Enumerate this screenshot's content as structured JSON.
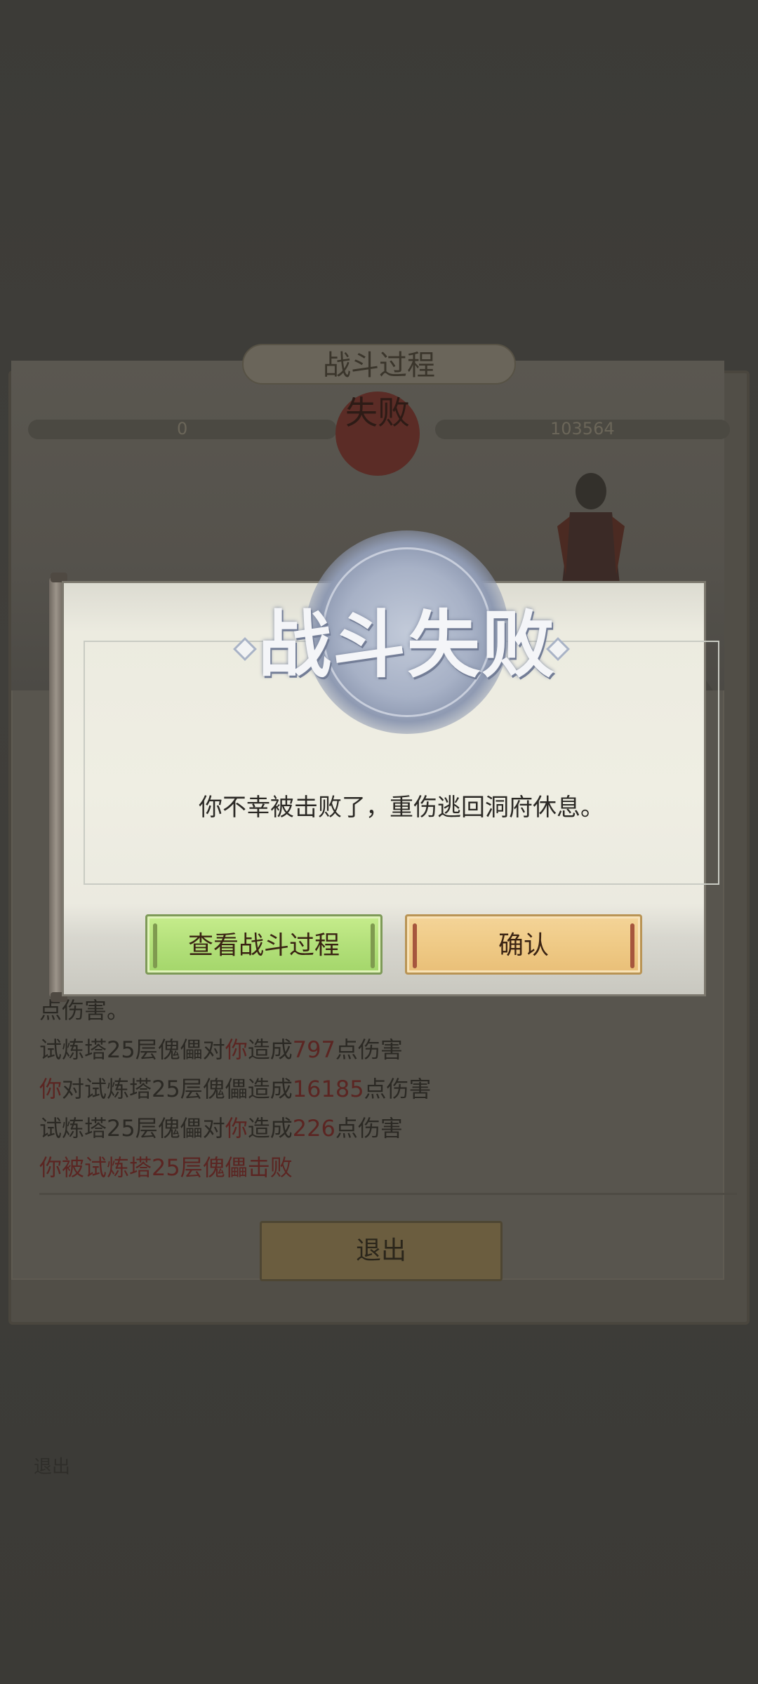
{
  "background": {
    "battle_window": {
      "title": "战斗过程",
      "result_seal": "失败",
      "player_hp": "0",
      "enemy_hp": "103564",
      "log_visible": [
        {
          "segments": [
            {
              "t": "点伤害。",
              "red": false
            }
          ]
        },
        {
          "segments": [
            {
              "t": "试炼塔25层傀儡对",
              "red": false
            },
            {
              "t": "你",
              "red": true
            },
            {
              "t": "造成",
              "red": false
            },
            {
              "t": "797",
              "red": true
            },
            {
              "t": "点伤害",
              "red": false
            }
          ]
        },
        {
          "segments": [
            {
              "t": "你",
              "red": true
            },
            {
              "t": "对试炼塔25层傀儡造成",
              "red": false
            },
            {
              "t": "16185",
              "red": true
            },
            {
              "t": "点伤害",
              "red": false
            }
          ]
        },
        {
          "segments": [
            {
              "t": "试炼塔25层傀儡对",
              "red": false
            },
            {
              "t": "你",
              "red": true
            },
            {
              "t": "造成",
              "red": false
            },
            {
              "t": "226",
              "red": true
            },
            {
              "t": "点伤害",
              "red": false
            }
          ]
        },
        {
          "segments": [
            {
              "t": "你被",
              "red": true
            },
            {
              "t": "试炼塔25层傀儡",
              "red": true
            },
            {
              "t": "击败",
              "red": true
            }
          ]
        }
      ],
      "exit_label": "退出"
    },
    "bottom_hint": "退出"
  },
  "dialog": {
    "title": "战斗失败",
    "message": "你不幸被击败了，重伤逃回洞府休息。",
    "view_battle_label": "查看战斗过程",
    "confirm_label": "确认"
  },
  "colors": {
    "overlay": "#3a3935",
    "green_button": "#b3e07a",
    "orange_button": "#efca86",
    "log_red": "#5b2522"
  }
}
